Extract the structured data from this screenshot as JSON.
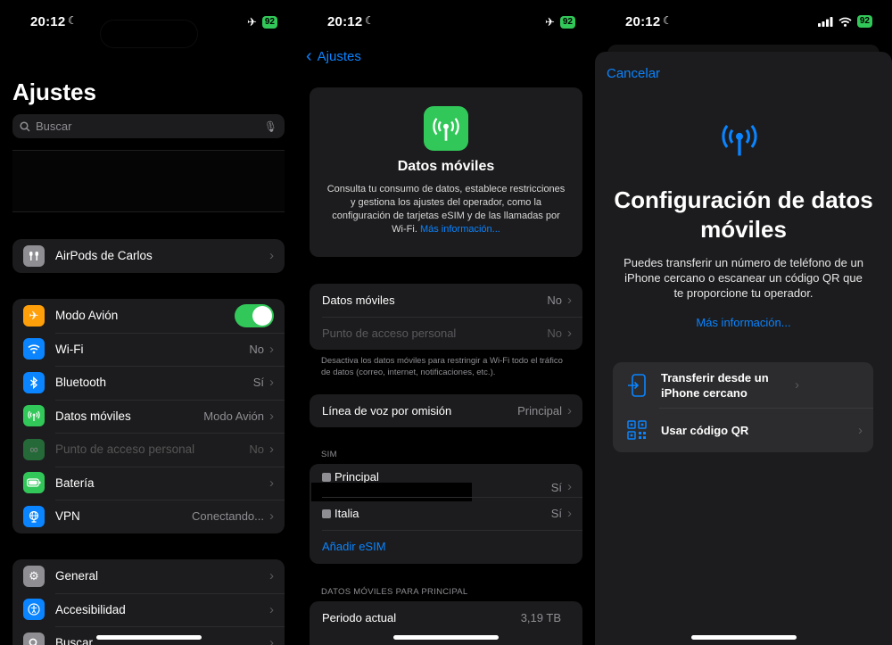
{
  "status": {
    "s1": {
      "time": "20:12",
      "battery": "92"
    },
    "s2": {
      "time": "20:12",
      "battery": "92"
    },
    "s3": {
      "time": "20:12",
      "battery": "92"
    }
  },
  "settings": {
    "title": "Ajustes",
    "search_placeholder": "Buscar",
    "airpods": {
      "label": "AirPods de Carlos"
    },
    "connectivity": [
      {
        "label": "Modo Avión",
        "value": ""
      },
      {
        "label": "Wi-Fi",
        "value": "No"
      },
      {
        "label": "Bluetooth",
        "value": "Sí"
      },
      {
        "label": "Datos móviles",
        "value": "Modo Avión"
      },
      {
        "label": "Punto de acceso personal",
        "value": "No"
      },
      {
        "label": "Batería",
        "value": ""
      },
      {
        "label": "VPN",
        "value": "Conectando..."
      }
    ],
    "general": [
      {
        "label": "General"
      },
      {
        "label": "Accesibilidad"
      },
      {
        "label": "Buscar"
      }
    ]
  },
  "cellular": {
    "back_label": "Ajustes",
    "hero": {
      "title": "Datos móviles",
      "description": "Consulta tu consumo de datos, establece restricciones y gestiona los ajustes del operador, como la configuración de tarjetas eSIM y de las llamadas por Wi-Fi.",
      "more_link": "Más información..."
    },
    "data_rows": [
      {
        "label": "Datos móviles",
        "value": "No"
      },
      {
        "label": "Punto de acceso personal",
        "value": "No"
      }
    ],
    "footer_note": "Desactiva los datos móviles para restringir a Wi-Fi todo el tráfico de datos (correo, internet, notificaciones, etc.).",
    "voice_line": {
      "label": "Línea de voz por omisión",
      "value": "Principal"
    },
    "sim_header": "SIM",
    "sims": [
      {
        "label": "Principal",
        "value": "Sí"
      },
      {
        "label": "Italia",
        "value": "Sí"
      }
    ],
    "add_esim": "Añadir eSIM",
    "usage_header": "DATOS MÓVILES PARA PRINCIPAL",
    "usage": {
      "label": "Periodo actual",
      "value": "3,19 TB"
    }
  },
  "setup": {
    "cancel": "Cancelar",
    "title": "Configuración de datos móviles",
    "description": "Puedes transferir un número de teléfono de un iPhone cercano o escanear un código QR que te proporcione tu operador.",
    "more_link": "Más información...",
    "options": [
      {
        "label": "Transferir desde un iPhone cercano"
      },
      {
        "label": "Usar código QR"
      }
    ]
  },
  "colors": {
    "accent": "#0a84ff",
    "green": "#32c759",
    "orange": "#ff9f0a"
  }
}
